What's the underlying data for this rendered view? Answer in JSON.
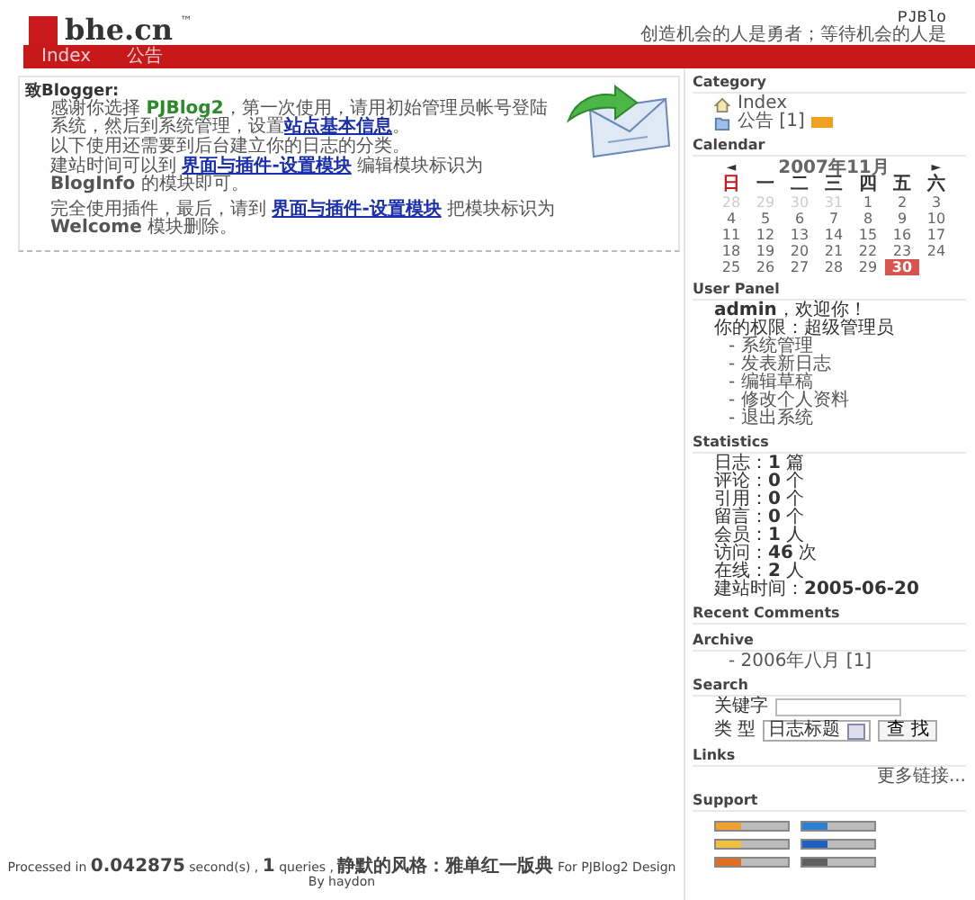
{
  "header": {
    "logo_text": "bhe.cn",
    "trademark": "™",
    "site_name": "PJBlo",
    "slogan": "创造机会的人是勇者；等待机会的人是"
  },
  "nav": [
    {
      "label": "Index"
    },
    {
      "label": "公告"
    }
  ],
  "welcome": {
    "greeting": "致Blogger:",
    "paragraphs": [
      [
        {
          "kind": "text",
          "text": "感谢你选择 "
        },
        {
          "kind": "product",
          "text": "PJBlog2"
        },
        {
          "kind": "text",
          "text": "，第一次使用，请用初始管理员帐号登陆系统，然后到系统管理，设置"
        },
        {
          "kind": "link",
          "text": "站点基本信息"
        },
        {
          "kind": "text",
          "text": "。"
        }
      ],
      [
        {
          "kind": "text",
          "text": "以下使用还需要到后台建立你的日志的分类。"
        }
      ],
      [
        {
          "kind": "text",
          "text": "建站时间可以到 "
        },
        {
          "kind": "link",
          "text": "界面与插件-设置模块"
        },
        {
          "kind": "text",
          "text": " 编辑模块标识为 "
        },
        {
          "kind": "strong",
          "text": "BlogInfo"
        },
        {
          "kind": "text",
          "text": " 的模块即可。"
        }
      ],
      [
        {
          "kind": "text",
          "text": "完全使用插件，最后，请到 "
        },
        {
          "kind": "link",
          "text": "界面与插件-设置模块"
        },
        {
          "kind": "text",
          "text": " 把模块标识为 "
        },
        {
          "kind": "strong",
          "text": "Welcome"
        },
        {
          "kind": "text",
          "text": " 模块删除。"
        }
      ]
    ]
  },
  "sidebar": [
    {
      "kind": "category",
      "title": "Category",
      "items": [
        {
          "label": "Index",
          "kind": "home",
          "feed": false
        },
        {
          "label": "公告 [1]",
          "kind": "folder",
          "feed": true
        }
      ]
    },
    {
      "kind": "calendar",
      "title": "Calendar",
      "prev": "◄",
      "month": "2007年11月",
      "next": "►",
      "weekdays": [
        "日",
        "一",
        "二",
        "三",
        "四",
        "五",
        "六"
      ],
      "weeks": [
        [
          {
            "day": "28",
            "muted": true,
            "selected": false
          },
          {
            "day": "29",
            "muted": true,
            "selected": false
          },
          {
            "day": "30",
            "muted": true,
            "selected": false
          },
          {
            "day": "31",
            "muted": true,
            "selected": false
          },
          {
            "day": "1",
            "muted": false,
            "selected": false
          },
          {
            "day": "2",
            "muted": false,
            "selected": false
          },
          {
            "day": "3",
            "muted": false,
            "selected": false
          }
        ],
        [
          {
            "day": "4",
            "muted": false,
            "selected": false
          },
          {
            "day": "5",
            "muted": false,
            "selected": false
          },
          {
            "day": "6",
            "muted": false,
            "selected": false
          },
          {
            "day": "7",
            "muted": false,
            "selected": false
          },
          {
            "day": "8",
            "muted": false,
            "selected": false
          },
          {
            "day": "9",
            "muted": false,
            "selected": false
          },
          {
            "day": "10",
            "muted": false,
            "selected": false
          }
        ],
        [
          {
            "day": "11",
            "muted": false,
            "selected": false
          },
          {
            "day": "12",
            "muted": false,
            "selected": false
          },
          {
            "day": "13",
            "muted": false,
            "selected": false
          },
          {
            "day": "14",
            "muted": false,
            "selected": false
          },
          {
            "day": "15",
            "muted": false,
            "selected": false
          },
          {
            "day": "16",
            "muted": false,
            "selected": false
          },
          {
            "day": "17",
            "muted": false,
            "selected": false
          }
        ],
        [
          {
            "day": "18",
            "muted": false,
            "selected": false
          },
          {
            "day": "19",
            "muted": false,
            "selected": false
          },
          {
            "day": "20",
            "muted": false,
            "selected": false
          },
          {
            "day": "21",
            "muted": false,
            "selected": false
          },
          {
            "day": "22",
            "muted": false,
            "selected": false
          },
          {
            "day": "23",
            "muted": false,
            "selected": false
          },
          {
            "day": "24",
            "muted": false,
            "selected": false
          }
        ],
        [
          {
            "day": "25",
            "muted": false,
            "selected": false
          },
          {
            "day": "26",
            "muted": false,
            "selected": false
          },
          {
            "day": "27",
            "muted": false,
            "selected": false
          },
          {
            "day": "28",
            "muted": false,
            "selected": false
          },
          {
            "day": "29",
            "muted": false,
            "selected": false
          },
          {
            "day": "30",
            "muted": false,
            "selected": true
          }
        ]
      ]
    },
    {
      "kind": "userpanel",
      "title": "User Panel",
      "welcome": "**admin**，欢迎你！",
      "role": "你的权限：超级管理员",
      "links": [
        "- 系统管理",
        "- 发表新日志",
        "- 编辑草稿",
        "- 修改个人资料",
        "- 退出系统"
      ]
    },
    {
      "kind": "stats",
      "title": "Statistics",
      "lines": [
        "日志：**1** 篇",
        "评论：**0** 个",
        "引用：**0** 个",
        "留言：**0** 个",
        "会员：**1** 人",
        "访问：**46** 次",
        "在线：**2** 人",
        "建站时间：**2005-06-20**"
      ]
    },
    {
      "kind": "comments",
      "title": "Recent Comments"
    },
    {
      "kind": "archive",
      "title": "Archive",
      "items": [
        "- 2006年八月 [1]"
      ]
    },
    {
      "kind": "search",
      "title": "Search",
      "keyword_label": "关键字",
      "type_label": "类 型",
      "type_value": "日志标题",
      "button": "查 找"
    },
    {
      "kind": "links",
      "title": "Links",
      "more": "更多链接..."
    },
    {
      "kind": "support",
      "title": "Support",
      "badges": [
        {
          "color": "#f0a030"
        },
        {
          "color": "#f0c040"
        },
        {
          "color": "#e07020"
        },
        {
          "color": "#3080d0"
        },
        {
          "color": "#2060c0"
        },
        {
          "color": "#606060"
        }
      ]
    }
  ],
  "footer": "Processed in **0.042875** second(s) , **1** queries , **静默的风格：雅单红一版典** For PJBlog2 Design By haydon"
}
